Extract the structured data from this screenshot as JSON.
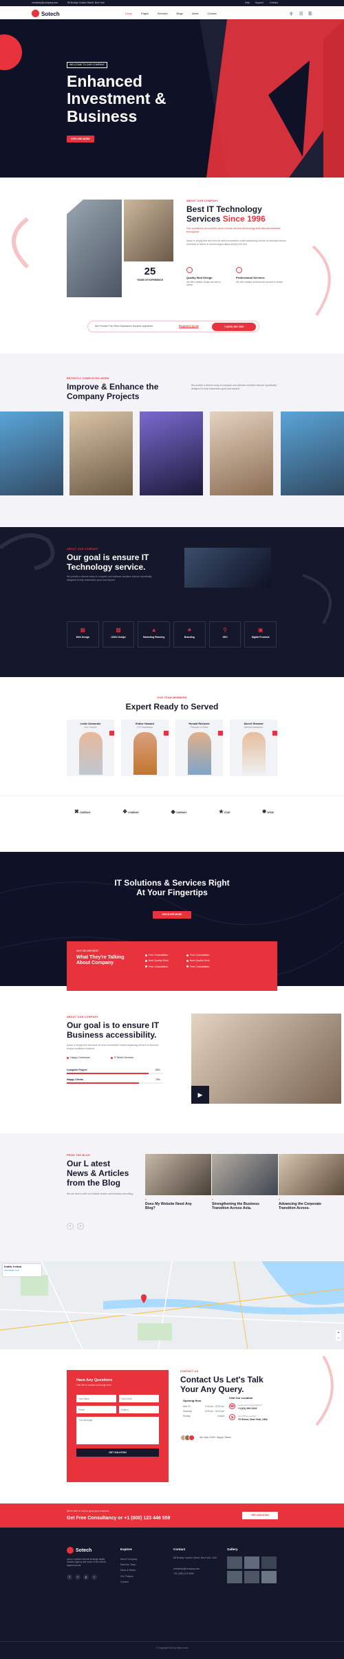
{
  "topbar": {
    "email": "needhelp@company.com",
    "address": "88 Broklyn Golden Street. New York",
    "links": [
      "Help",
      "Support",
      "Contact"
    ]
  },
  "header": {
    "logo": "Sotech",
    "nav": [
      "Home",
      "Pages",
      "Services",
      "Blogs",
      "News",
      "Contact"
    ]
  },
  "hero": {
    "kicker": "WELCOME TO OUR COMPANY",
    "title_1": "Enhanced",
    "title_2": "Investment &",
    "title_3": "Business",
    "button": "EXPLORE MORE"
  },
  "about": {
    "kicker": "ABOUT OUR COMPANY",
    "title_1": "Best IT Technology",
    "title_2": "Services ",
    "title_accent": "Since 1996",
    "lead": "Our operations around the world ensure service technology and rational business throughout",
    "body": "Ipsum is simply free text dolor sit amet consectetur notted adipisicing elit sed do eiusmod tempor incididunt ut labore et dolore magna aliqua simply free text.",
    "years": "25",
    "years_label": "YEARS OF EXPERIENCE",
    "feat1": "Quality Web Design",
    "feat1_sub": "We offer multiple design services to clients",
    "feat2": "Professional Services",
    "feat2_sub": "We offer multiple professional services to clients",
    "cta_text": "We Provide Full Office Assistance Anytime anywhere.",
    "cta_link": "Request A Quote",
    "cta_phone": "+1(826) 456-7890"
  },
  "improve": {
    "kicker": "RECENTLY COMPLETED WORK",
    "title_1": "Improve & Enhance the",
    "title_2": "Company Projects",
    "text": "We provide a diverse array of computer and software solutions that are specifically designed to help businesses grow and expand."
  },
  "goal": {
    "kicker": "ABOUT OUR COMPANY",
    "title_1": "Our goal is ensure IT",
    "title_2": "Technology service.",
    "text": "We provide a diverse array of computer and software solutions that are specifically designed to help businesses grow and expand.",
    "cards": [
      "Web Design",
      "UI/UX Design",
      "Marketing Planning",
      "Branding",
      "SEO",
      "Digital Products"
    ]
  },
  "team": {
    "kicker": "OUR TEAM MEMBERS",
    "title": "Expert Ready to Served",
    "members": [
      {
        "name": "Leslie Alexander",
        "role": "Ceo Founder"
      },
      {
        "name": "Esther Howard",
        "role": "CTO Assistance"
      },
      {
        "name": "Ronald Richards",
        "role": "President of Sales"
      },
      {
        "name": "Darrell Steward",
        "role": "Medical Assistance"
      }
    ],
    "brands": [
      "COMPANY",
      "COMPANY",
      "COMPANY",
      "STAR",
      "SPIDE"
    ]
  },
  "solutions": {
    "title_1": "IT Solutions & Services Right",
    "title_2": "At Your Fingertips",
    "button": "DISCOVER MORE"
  },
  "why": {
    "kicker": "WHY WE ARE BEST",
    "title_1": "What They're Talking",
    "title_2": "About Company",
    "items": [
      "Free Consultation",
      "Best Quality Work",
      "Free Consultation",
      "Free Consultation",
      "Best Quality Work",
      "Free Consultation"
    ]
  },
  "accessibility": {
    "kicker": "ABOUT OUR COMPANY",
    "title_1": "Our goal is to ensure IT",
    "title_2": "Business accessibility.",
    "text": "Ipsum is simply free text dolor sit amet consectetur notted adipisicing elit sed do eiusmod tempor incididunt ut labore.",
    "check1": "Happy Customers",
    "check2": "IT World Services",
    "bar1_label": "Complete Project",
    "bar1_value": "85%",
    "bar2_label": "Happy Clients",
    "bar2_value": "75%"
  },
  "news": {
    "kicker": "FROM THE BLOG",
    "title_1": "Our L atest",
    "title_2": "News & Articles",
    "title_3": "from the Blog",
    "text": "We are here to offer our trusted service and business consulting.",
    "posts": [
      {
        "title_1": "Does My Website Need Any",
        "title_2": "Blog?"
      },
      {
        "title_1": "Strengthening the Business",
        "title_2": "Transition Across Asia."
      },
      {
        "title_1": "Advancing the Corporate",
        "title_2": "Transition Across."
      }
    ]
  },
  "map": {
    "place": "Dublin, Ireland",
    "link": "View larger map"
  },
  "contact": {
    "form_title": "Have Any Questions",
    "form_sub": "Feel free to contact us through form",
    "ph_name": "Your Name",
    "ph_email": "Your Email",
    "ph_phone": "Phone",
    "ph_subject": "Subject",
    "ph_message": "Your Message",
    "submit": "GET SOLUTION",
    "kicker": "CONTACT US",
    "title_1": "Contact Us Let's Talk",
    "title_2": "Your Any Query.",
    "hours_title": "Opening Hour",
    "hours": [
      {
        "d": "Mon-Fri",
        "t": "9:00 am - 18:00 pm"
      },
      {
        "d": "Saturday",
        "t": "8:00 am - 18:00 pm"
      },
      {
        "d": "Sunday",
        "t": "Closed"
      }
    ],
    "visit_title": "Visit Our Location",
    "phone_label": "Looking For Consultation?",
    "phone": "+1 (61) 000 2222",
    "address_label": "Our Office Location",
    "address": "70 Street, New York, USA",
    "clients": "We have 2200+ Happy Clients"
  },
  "newsletter": {
    "text": "We're here to help to grow your business",
    "title": "Get Free Consultancy or +1 (800) 123 446 559",
    "button": "GET SOLUTION"
  },
  "footer": {
    "logo": "Sotech",
    "about": "Ipsum a global external strategic digital creative agency with some of the world's largest brands.",
    "explore_title": "Explore",
    "explore": [
      "About Company",
      "Meet the Team",
      "News & Media",
      "Our Projects",
      "Contact"
    ],
    "contact_title": "Contact",
    "address": "88 Broklyn Golden Street. New York, USA",
    "email": "needhelp@company.com",
    "phone": "+92 (456) 123 5555",
    "gallery_title": "Gallery",
    "copyright": "© Copyright 2024 by Sotech.com"
  },
  "colors": {
    "accent": "#e8333c",
    "dark": "#15172b",
    "darker": "#0f1226"
  }
}
